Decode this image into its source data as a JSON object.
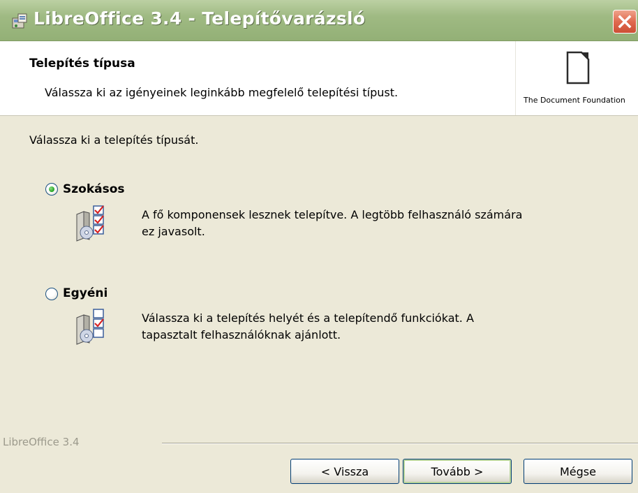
{
  "window": {
    "title": "LibreOffice 3.4 - Telepítővarázsló",
    "icon": "installer-icon",
    "close_icon": "close-icon"
  },
  "header": {
    "title": "Telepítés típusa",
    "subtitle": "Válassza ki az igényeinek leginkább megfelelő telepítési típust.",
    "logo_text": "The Document Foundation",
    "logo_icon": "document-icon"
  },
  "main": {
    "prompt": "Válassza ki a telepítés típusát.",
    "options": [
      {
        "label": "Szokásos",
        "selected": true,
        "description_line1": "A fő komponensek lesznek telepítve. A legtöbb felhasználó számára",
        "description_line2": "ez javasolt.",
        "icon": "typical-setup-icon"
      },
      {
        "label": "Egyéni",
        "selected": false,
        "description_line1": "Válassza ki a telepítés helyét és a telepítendő funkciókat. A",
        "description_line2": "tapasztalt felhasználóknak ajánlott.",
        "icon": "custom-setup-icon"
      }
    ]
  },
  "footer": {
    "brand": "LibreOffice 3.4",
    "back_label": "< Vissza",
    "next_label": "Tovább >",
    "cancel_label": "Mégse"
  },
  "colors": {
    "titlebar": "#9fba83",
    "dialog_bg": "#ece9d8",
    "close_button": "#e06a4f",
    "radio_selected": "#21a121"
  }
}
